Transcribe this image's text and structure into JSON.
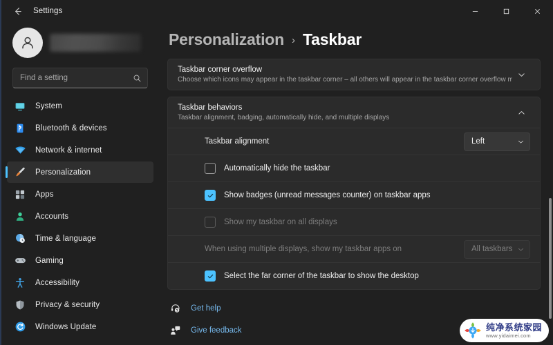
{
  "window": {
    "title": "Settings",
    "back_icon": "back-arrow-icon",
    "minimize_label": "–",
    "maximize_label": "□",
    "close_label": "✕"
  },
  "sidebar": {
    "account": {
      "name_redacted": "",
      "avatar_icon": "person-avatar-icon"
    },
    "search": {
      "placeholder": "Find a setting",
      "value": "",
      "icon": "search-icon"
    },
    "items": [
      {
        "label": "System",
        "icon": "monitor-icon",
        "color": "#4fc3d9",
        "selected": false
      },
      {
        "label": "Bluetooth & devices",
        "icon": "bluetooth-icon",
        "color": "#2d8cf0",
        "selected": false
      },
      {
        "label": "Network & internet",
        "icon": "wifi-icon",
        "color": "#2f9ce8",
        "selected": false
      },
      {
        "label": "Personalization",
        "icon": "paintbrush-icon",
        "color": "#e8833a",
        "selected": true
      },
      {
        "label": "Apps",
        "icon": "apps-grid-icon",
        "color": "#9aa3ab",
        "selected": false
      },
      {
        "label": "Accounts",
        "icon": "person-icon",
        "color": "#3fcf9a",
        "selected": false
      },
      {
        "label": "Time & language",
        "icon": "clock-globe-icon",
        "color": "#5aa9e6",
        "selected": false
      },
      {
        "label": "Gaming",
        "icon": "game-controller-icon",
        "color": "#b9c1c7",
        "selected": false
      },
      {
        "label": "Accessibility",
        "icon": "accessibility-person-icon",
        "color": "#3f9fe0",
        "selected": false
      },
      {
        "label": "Privacy & security",
        "icon": "shield-icon",
        "color": "#b5bcc2",
        "selected": false
      },
      {
        "label": "Windows Update",
        "icon": "update-refresh-icon",
        "color": "#2f9ce8",
        "selected": false
      }
    ]
  },
  "breadcrumb": {
    "parent": "Personalization",
    "separator": "›",
    "current": "Taskbar"
  },
  "cards": {
    "corner_overflow": {
      "title": "Taskbar corner overflow",
      "subtitle": "Choose which icons may appear in the taskbar corner – all others will appear in the taskbar corner overflow menu",
      "chevron": "chevron-down-icon",
      "expanded": false
    },
    "behaviors": {
      "title": "Taskbar behaviors",
      "subtitle": "Taskbar alignment, badging, automatically hide, and multiple displays",
      "chevron": "chevron-up-icon",
      "expanded": true,
      "rows": [
        {
          "type": "dropdown",
          "label": "Taskbar alignment",
          "value": "Left",
          "disabled": false,
          "annotated": true
        },
        {
          "type": "checkbox",
          "label": "Automatically hide the taskbar",
          "checked": false,
          "disabled": false
        },
        {
          "type": "checkbox",
          "label": "Show badges (unread messages counter) on taskbar apps",
          "checked": true,
          "disabled": false
        },
        {
          "type": "checkbox",
          "label": "Show my taskbar on all displays",
          "checked": false,
          "disabled": true
        },
        {
          "type": "dropdown",
          "label": "When using multiple displays, show my taskbar apps on",
          "value": "All taskbars",
          "disabled": true,
          "annotated": false
        },
        {
          "type": "checkbox",
          "label": "Select the far corner of the taskbar to show the desktop",
          "checked": true,
          "disabled": false
        }
      ]
    }
  },
  "footer_links": [
    {
      "label": "Get help",
      "icon": "help-headset-icon"
    },
    {
      "label": "Give feedback",
      "icon": "feedback-person-icon"
    }
  ],
  "annotation": {
    "type": "arrow",
    "color": "#e21b1b",
    "points_to": "taskbar-alignment-dropdown"
  },
  "watermark": {
    "title": "纯净系统家园",
    "url": "www.yidaimei.com"
  },
  "colors": {
    "accent": "#4cc2ff",
    "link": "#76b9ed",
    "page_bg": "#202020",
    "card_bg": "#2b2b2b",
    "annotation_red": "#e21b1b"
  }
}
